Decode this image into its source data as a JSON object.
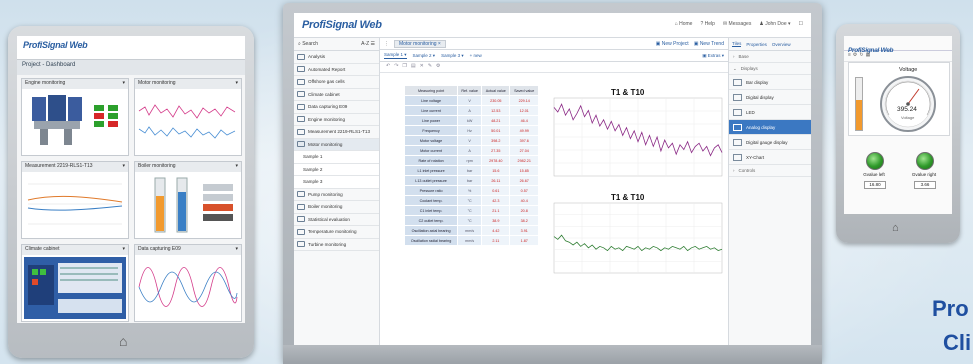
{
  "brand": {
    "logo_text": "ProfiSignal Web",
    "accent": "#2a5ea1",
    "promo_line1": "Pro",
    "promo_line2": "Cli"
  },
  "tablet": {
    "page_title": "Project - Dashboard",
    "tiles": [
      {
        "title": "Engine monitoring"
      },
      {
        "title": "Motor monitoring"
      },
      {
        "title": "Measurement 2219-RLS1-T13"
      },
      {
        "title": "Boiler monitoring"
      },
      {
        "title": "Climate cabinet"
      },
      {
        "title": "Data capturing E09"
      }
    ]
  },
  "monitor": {
    "nav": {
      "home": "Home",
      "help": "Help",
      "messages": "Messages",
      "user": "John Doe"
    },
    "search_placeholder": "Search",
    "search_sort": "A-Z",
    "sidebar": [
      {
        "label": "Analysis"
      },
      {
        "label": "Automated Report"
      },
      {
        "label": "Offshore gas cells"
      },
      {
        "label": "Climate cabinet"
      },
      {
        "label": "Data capturing E09"
      },
      {
        "label": "Engine monitoring"
      },
      {
        "label": "Measurement 2219-RLS1-T13"
      },
      {
        "label": "Motor monitoring"
      },
      {
        "label": "Sample 1",
        "sub": true
      },
      {
        "label": "Sample 2",
        "sub": true
      },
      {
        "label": "Sample 3",
        "sub": true
      },
      {
        "label": "Pump monitoring"
      },
      {
        "label": "Boiler monitoring"
      },
      {
        "label": "Statistical evaluation"
      },
      {
        "label": "Temperature monitoring"
      },
      {
        "label": "Turbine monitoring"
      }
    ],
    "tab_label": "Motor monitoring",
    "subtabs": [
      "Sample 1",
      "Sample 2",
      "Sample 3",
      "+ new"
    ],
    "buttons": {
      "new_project": "New Project",
      "new_trend": "New Trend",
      "extras": "Extras"
    },
    "table": {
      "headers": [
        "Measuring point",
        "Ref. value",
        "Actual value",
        "Saved value"
      ],
      "rows": [
        {
          "name": "Line voltage",
          "unit": "V",
          "actual": "230.05",
          "saved": "229.14"
        },
        {
          "name": "Line current",
          "unit": "A",
          "actual": "12.53",
          "saved": "12.01"
        },
        {
          "name": "Line power",
          "unit": "kW",
          "actual": "48.21",
          "saved": "46.4"
        },
        {
          "name": "Frequency",
          "unit": "Hz",
          "actual": "50.01",
          "saved": "49.99"
        },
        {
          "name": "Motor voltage",
          "unit": "V",
          "actual": "398.2",
          "saved": "397.6"
        },
        {
          "name": "Motor current",
          "unit": "A",
          "actual": "27.35",
          "saved": "27.04"
        },
        {
          "name": "Rate of rotation",
          "unit": "rpm",
          "actual": "2978.40",
          "saved": "2982.21"
        },
        {
          "name": "L1 inlet pressure",
          "unit": "bar",
          "actual": "15.6",
          "saved": "15.85"
        },
        {
          "name": "L13 outlet pressure",
          "unit": "bar",
          "actual": "26.11",
          "saved": "26.67"
        },
        {
          "name": "Pressure ratio",
          "unit": "%",
          "actual": "0.61",
          "saved": "0.57"
        },
        {
          "name": "Coolant temp.",
          "unit": "°C",
          "actual": "42.3",
          "saved": "40.4"
        },
        {
          "name": "C1 inlet temp.",
          "unit": "°C",
          "actual": "21.1",
          "saved": "20.8"
        },
        {
          "name": "C2 outlet temp.",
          "unit": "°C",
          "actual": "38.9",
          "saved": "38.2"
        },
        {
          "name": "Oscillation axial bearing",
          "unit": "mm/s",
          "actual": "4.42",
          "saved": "3.91"
        },
        {
          "name": "Oscillation radial bearing",
          "unit": "mm/s",
          "actual": "2.11",
          "saved": "1.87"
        }
      ]
    },
    "chart_title": "T1 & T10",
    "right_panel": {
      "tabs": [
        "Tiles",
        "Properties",
        "Overview"
      ],
      "sections": [
        "Base",
        "Displays",
        "Controls"
      ],
      "items": [
        "Bar display",
        "Digital display",
        "LED",
        "Analog display",
        "Digital gauge display",
        "XY-Chart"
      ],
      "selected": "Analog display"
    }
  },
  "phone": {
    "gauge_title": "Voltage",
    "gauge_value": "395.24",
    "gauge_unit": "Voltage",
    "lamps": [
      {
        "label": "Gvalue left",
        "value": "16.80"
      },
      {
        "label": "Gvalue right",
        "value": "3.66"
      }
    ]
  },
  "chart_data": [
    {
      "type": "line",
      "title": "T1 & T10",
      "series": [
        {
          "values": [
            8.4,
            8.1,
            8.6,
            7.9,
            8.3,
            7.6,
            8.0,
            8.5,
            7.8,
            8.2,
            7.4,
            7.9,
            7.2,
            7.6,
            7.0,
            7.5,
            6.9,
            7.3,
            6.6,
            7.1,
            6.4,
            6.9,
            6.2,
            6.8,
            6.0,
            6.6,
            5.9,
            6.5,
            5.6,
            6.3,
            5.8,
            6.1,
            5.4,
            6.0,
            5.7,
            6.2,
            5.5,
            5.9,
            6.1,
            5.6,
            5.9,
            5.3,
            5.8,
            6.0,
            5.5
          ]
        }
      ],
      "ylim": [
        4,
        9
      ]
    },
    {
      "type": "line",
      "title": "T1 & T10",
      "series": [
        {
          "values": [
            6.6,
            6.4,
            6.7,
            6.3,
            6.2,
            6.0,
            6.2,
            5.9,
            6.1,
            5.8,
            6.0,
            5.7,
            5.9,
            5.8,
            5.6,
            5.9,
            5.7,
            5.8,
            5.6,
            5.9,
            5.8,
            5.7,
            5.9,
            5.6,
            5.8,
            5.7,
            5.9,
            5.8,
            5.6,
            5.8,
            5.7,
            5.9,
            5.8,
            5.7,
            5.9,
            5.6,
            5.8,
            5.9,
            5.7,
            5.8,
            5.9,
            5.7,
            5.8,
            5.6,
            5.7
          ]
        }
      ],
      "ylim": [
        4,
        9
      ]
    }
  ]
}
